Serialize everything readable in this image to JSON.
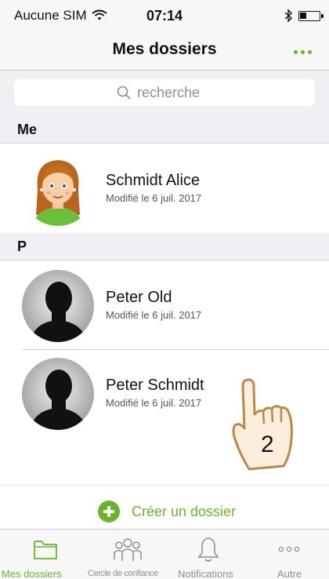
{
  "statusbar": {
    "carrier": "Aucune SIM",
    "time": "07:14",
    "battery_level": 0.35
  },
  "navbar": {
    "title": "Mes dossiers",
    "more_icon": "more-dots-icon"
  },
  "search": {
    "placeholder": "recherche"
  },
  "sections": [
    {
      "label": "Me"
    },
    {
      "label": "P"
    }
  ],
  "folders": [
    {
      "name": "Schmidt Alice",
      "modified": "Modifié le 6 juil. 2017",
      "avatar": "cartoon-woman-avatar"
    },
    {
      "name": "Peter Old",
      "modified": "Modifié le 6 juil. 2017",
      "avatar": "silhouette-avatar"
    },
    {
      "name": "Peter Schmidt",
      "modified": "Modifié le 6 juil. 2017",
      "avatar": "silhouette-avatar"
    }
  ],
  "create": {
    "label": "Créer un dossier",
    "icon": "plus-circle-icon"
  },
  "tabs": [
    {
      "label": "Mes dossiers",
      "icon": "folder-icon",
      "active": true
    },
    {
      "label": "Cercle de confiance",
      "icon": "people-circle-icon",
      "active": false
    },
    {
      "label": "Notifications",
      "icon": "bell-icon",
      "active": false
    },
    {
      "label": "Autre",
      "icon": "more-dots-icon",
      "active": false
    }
  ],
  "annotation": {
    "step": "2",
    "icon": "pointing-hand-icon"
  },
  "colors": {
    "accent": "#6ab42d",
    "background": "#efeff4",
    "bars": "#f7f7f7"
  }
}
